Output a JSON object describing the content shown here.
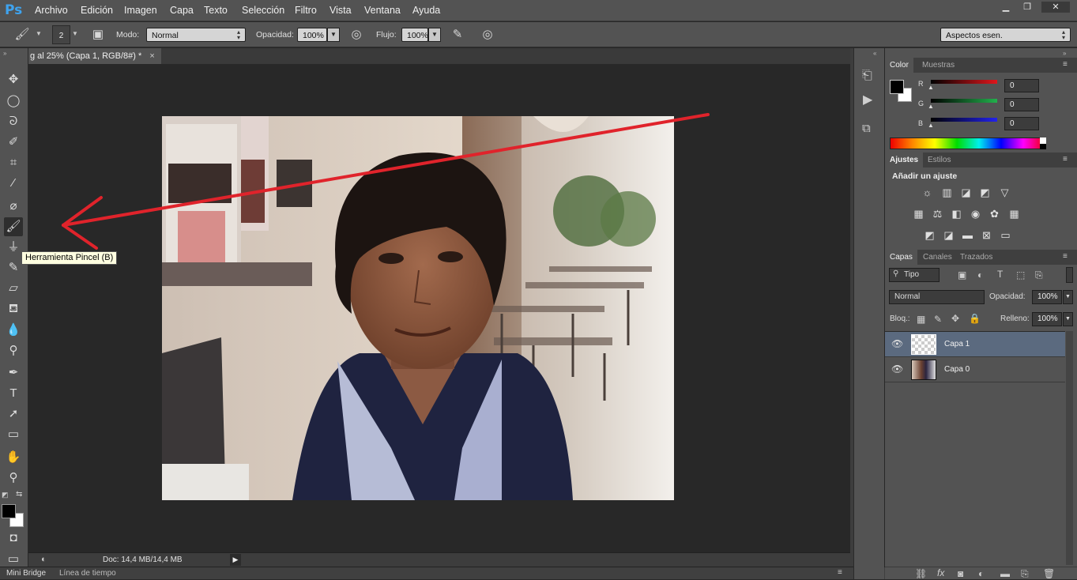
{
  "app": {
    "logo": "Ps"
  },
  "menu": [
    "Archivo",
    "Edición",
    "Imagen",
    "Capa",
    "Texto",
    "Selección",
    "Filtro",
    "Vista",
    "Ventana",
    "Ayuda"
  ],
  "options": {
    "brush_size": "2",
    "mode_label": "Modo:",
    "mode_value": "Normal",
    "opacity_label": "Opacidad:",
    "opacity_value": "100%",
    "flow_label": "Flujo:",
    "flow_value": "100%",
    "workspace": "Aspectos esen."
  },
  "document": {
    "tab_title": "g al 25% (Capa 1, RGB/8#) *",
    "close": "×"
  },
  "tooltip": "Herramienta Pincel (B)",
  "status": {
    "doc": "Doc: 14,4 MB/14,4 MB"
  },
  "bottom_tabs": [
    "Mini Bridge",
    "Línea de tiempo"
  ],
  "color_panel": {
    "tabs": [
      "Color",
      "Muestras"
    ],
    "channels": [
      {
        "name": "R",
        "value": "0",
        "color": "#e0161c"
      },
      {
        "name": "G",
        "value": "0",
        "color": "#22b14c"
      },
      {
        "name": "B",
        "value": "0",
        "color": "#2222ee"
      }
    ],
    "foreground": "#000000",
    "background": "#ffffff"
  },
  "adjust_panel": {
    "tabs": [
      "Ajustes",
      "Estilos"
    ],
    "heading": "Añadir un ajuste"
  },
  "layers_panel": {
    "tabs": [
      "Capas",
      "Canales",
      "Trazados"
    ],
    "filter": "Tipo",
    "blend_mode": "Normal",
    "opacity_label": "Opacidad:",
    "opacity_value": "100%",
    "lock_label": "Bloq.:",
    "fill_label": "Relleno:",
    "fill_value": "100%",
    "layers": [
      {
        "name": "Capa 1",
        "selected": true
      },
      {
        "name": "Capa 0",
        "selected": false
      }
    ]
  },
  "annotation": {
    "color": "#e0232b"
  }
}
